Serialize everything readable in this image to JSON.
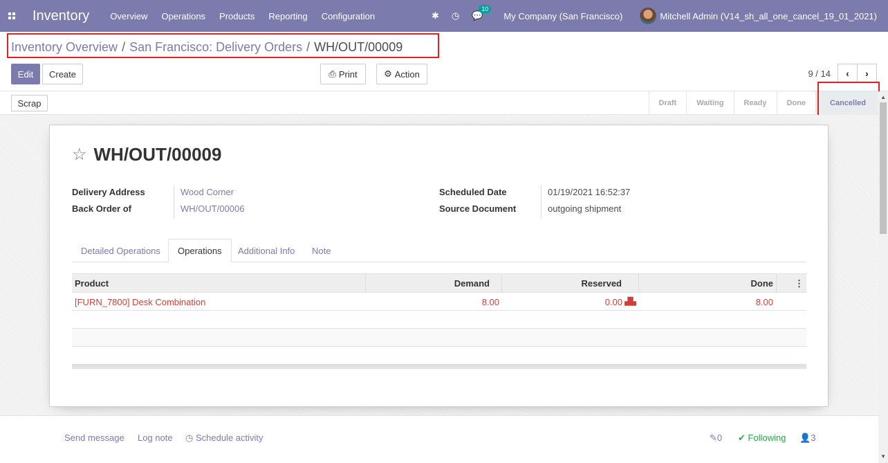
{
  "navbar": {
    "app_name": "Inventory",
    "menu": [
      "Overview",
      "Operations",
      "Products",
      "Reporting",
      "Configuration"
    ],
    "messages_count": "10",
    "company": "My Company (San Francisco)",
    "user": "Mitchell Admin (V14_sh_all_one_cancel_19_01_2021)"
  },
  "breadcrumb": {
    "items": [
      "Inventory Overview",
      "San Francisco: Delivery Orders"
    ],
    "current": "WH/OUT/00009"
  },
  "toolbar": {
    "edit": "Edit",
    "create": "Create",
    "print": "Print",
    "action": "Action",
    "pager": "9 / 14"
  },
  "statusbar": {
    "scrap": "Scrap",
    "stages": [
      "Draft",
      "Waiting",
      "Ready",
      "Done",
      "Cancelled"
    ],
    "current_stage": "Cancelled"
  },
  "record": {
    "title": "WH/OUT/00009",
    "delivery_address_label": "Delivery Address",
    "delivery_address": "Wood Corner",
    "back_order_label": "Back Order of",
    "back_order": "WH/OUT/00006",
    "scheduled_date_label": "Scheduled Date",
    "scheduled_date": "01/19/2021 16:52:37",
    "source_document_label": "Source Document",
    "source_document": "outgoing shipment"
  },
  "tabs": [
    "Detailed Operations",
    "Operations",
    "Additional Info",
    "Note"
  ],
  "active_tab": "Operations",
  "table": {
    "columns": [
      "Product",
      "Demand",
      "Reserved",
      "Done"
    ],
    "rows": [
      {
        "product": "[FURN_7800] Desk Combination",
        "demand": "8.00",
        "reserved": "0.00",
        "done": "8.00"
      }
    ]
  },
  "chatter": {
    "send_message": "Send message",
    "log_note": "Log note",
    "schedule_activity": "Schedule activity",
    "attachments": "0",
    "following": "Following",
    "followers": "3"
  },
  "colors": {
    "brand": "#7c7bad",
    "highlight_box": "#e02020",
    "product_text": "#d23f3a"
  }
}
